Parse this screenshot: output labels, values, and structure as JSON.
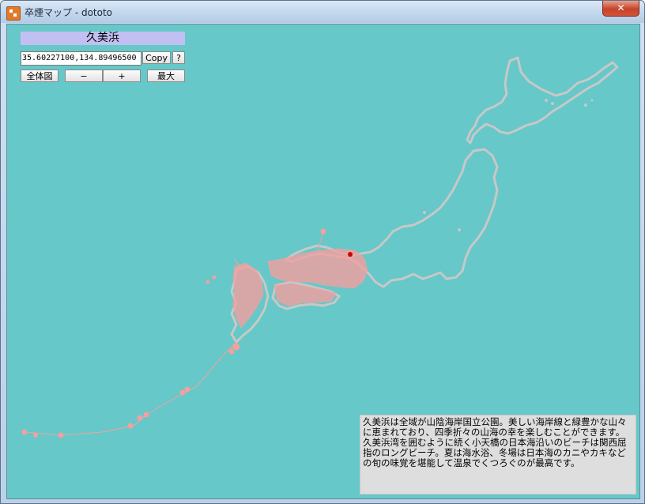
{
  "window": {
    "title": "卒煙マップ - dototo",
    "close_label": "✕"
  },
  "place": {
    "name": "久美浜",
    "coords": "35.60227100,134.89496500"
  },
  "toolbar": {
    "copy_label": "Copy",
    "help_label": "?",
    "overview_label": "全体図",
    "zoom_out_label": "−",
    "zoom_in_label": "+",
    "max_label": "最大"
  },
  "info": {
    "text": "久美浜は全域が山陰海岸国立公園。美しい海岸線と緑豊かな山々に恵まれており、四季折々の山海の幸を楽しむことができます。久美浜湾を囲むように続く小天橋の日本海沿いのビーチは関西屈指のロングビーチ。夏は海水浴、冬場は日本海のカニやカキなどの旬の味覚を堪能して温泉でくつろぐのが最高です。"
  },
  "colors": {
    "sea": "#66c8c8",
    "land_outline": "#c8c8c8",
    "visited_region": "#f4a0a0",
    "marker": "#cc0000"
  }
}
